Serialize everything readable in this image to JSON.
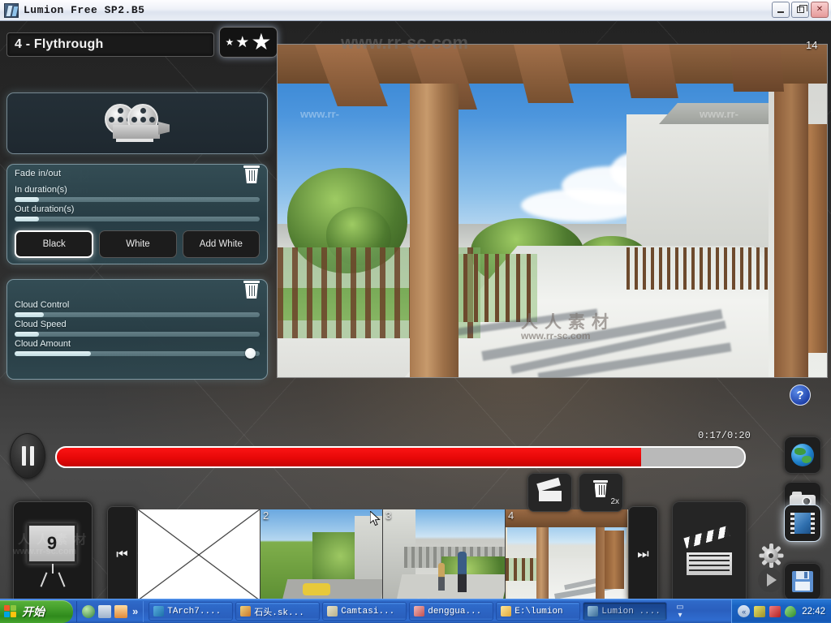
{
  "window": {
    "title": "Lumion Free SP2.B5",
    "app_icon": "lumion-leaf-icon",
    "minimize_label": "Minimize",
    "restore_label": "Restore",
    "close_label": "Close"
  },
  "watermarks": {
    "top_url": "www.rr-sc.com",
    "viewport_url_left": "www.rr-",
    "viewport_url_right": "www.rr-",
    "viewport_cn": "人人素材",
    "viewport_url": "www.rr-sc.com",
    "panel_cn": "人人素材",
    "panel_url": "www.rr-sc.com",
    "timeline_cn": "人人素材",
    "timeline_url": "www.rr-sc.com",
    "bottom_cn": "人人素材"
  },
  "clip_editor": {
    "clip_name": "4 - Flythrough",
    "effects_button": "three-stars",
    "projector_icon": "movie-projector-icon"
  },
  "effects": [
    {
      "title": "Fade in/out",
      "delete_label": "Delete effect",
      "sliders": [
        {
          "label": "In duration(s)",
          "fill_pct": 10
        },
        {
          "label": "Out duration(s)",
          "fill_pct": 10
        }
      ],
      "buttons": [
        {
          "label": "Black",
          "selected": true
        },
        {
          "label": "White",
          "selected": false
        },
        {
          "label": "Add White",
          "selected": false
        }
      ]
    },
    {
      "title": "Cloud Control",
      "delete_label": "Delete effect",
      "sliders": [
        {
          "label": "Cloud Control",
          "fill_pct": 12
        },
        {
          "label": "Cloud Speed",
          "fill_pct": 10
        },
        {
          "label": "Cloud Amount",
          "fill_pct": 31,
          "has_knob": true,
          "knob_pct": 96
        }
      ]
    }
  ],
  "viewport": {
    "index_label": "14",
    "scene_description": "pergola terrace with wooden beams"
  },
  "transport": {
    "pause_label": "Pause",
    "time_display": "0:17/0:20",
    "progress_pct": 85
  },
  "timeline": {
    "screen_button_number": "9",
    "prev_label": "Previous clip",
    "next_label": "Next clip",
    "record_button": "clapperboard-icon",
    "delete_button": "trash-icon",
    "delete_badge": "2x",
    "movie_panel_icon": "clapperboard-icon",
    "clips": [
      {
        "number": "",
        "type": "blank",
        "selected": false
      },
      {
        "number": "2",
        "type": "street-scene",
        "selected": false
      },
      {
        "number": "3",
        "type": "garden-path-scene",
        "selected": false
      },
      {
        "number": "4",
        "type": "pergola-scene",
        "selected": true
      }
    ]
  },
  "right_toolbar": {
    "help_label": "?",
    "items": [
      {
        "icon": "globe-icon",
        "label": "Build mode",
        "active": false
      },
      {
        "icon": "camera-icon",
        "label": "Photo mode",
        "active": false
      },
      {
        "icon": "film-icon",
        "label": "Movie mode",
        "active": true
      },
      {
        "icon": "save-icon",
        "label": "Save",
        "active": false
      }
    ],
    "settings_icon": "gear-icon",
    "play_icon": "play-icon"
  },
  "taskbar": {
    "start_label": "开始",
    "quicklaunch": [
      "browser-icon",
      "notepad-icon",
      "media-icon"
    ],
    "quicklaunch_more": "»",
    "tasks": [
      {
        "label": "TArch7....",
        "active": false
      },
      {
        "label": "石头.sk...",
        "active": false
      },
      {
        "label": "Camtasi...",
        "active": false
      },
      {
        "label": "denggua...",
        "active": false
      },
      {
        "label": "E:\\lumion",
        "active": false
      },
      {
        "label": "Lumion ....",
        "active": true
      }
    ],
    "scroll_glyph": "▾",
    "tray": {
      "arrow": "«",
      "icons": [
        "key-icon",
        "antivirus-icon",
        "shield-icon"
      ],
      "clock": "22:42"
    }
  }
}
